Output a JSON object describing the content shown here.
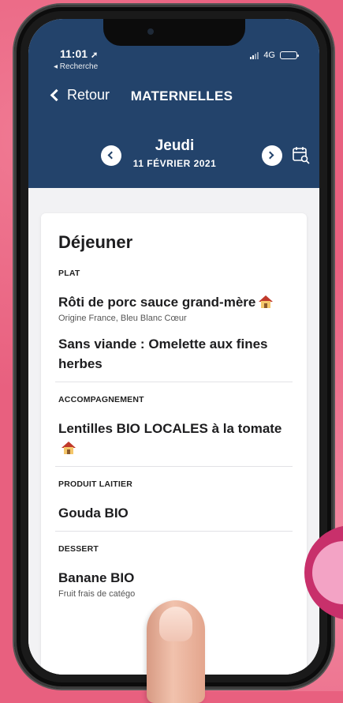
{
  "status": {
    "time": "11:01",
    "back_app": "◂ Recherche",
    "network": "4G",
    "battery_level": 0.85
  },
  "nav": {
    "back_label": "Retour",
    "title": "MATERNELLES"
  },
  "date": {
    "day": "Jeudi",
    "full": "11 FÉVRIER 2021"
  },
  "menu": {
    "meal_title": "Déjeuner",
    "sections": [
      {
        "label": "PLAT",
        "dishes": [
          {
            "name": "Rôti de porc sauce grand-mère",
            "local_icon": "house-icon",
            "note": "Origine France, Bleu Blanc Cœur"
          },
          {
            "name": "Sans viande : Omelette aux fines herbes"
          }
        ]
      },
      {
        "label": "ACCOMPAGNEMENT",
        "dishes": [
          {
            "name": "Lentilles BIO LOCALES à la tomate",
            "local_icon": "house-icon"
          }
        ]
      },
      {
        "label": "PRODUIT LAITIER",
        "dishes": [
          {
            "name": "Gouda BIO"
          }
        ]
      },
      {
        "label": "DESSERT",
        "dishes": [
          {
            "name": "Banane BIO",
            "note": "Fruit frais de catégo"
          }
        ]
      }
    ]
  },
  "colors": {
    "header_bg": "#23436b",
    "page_bg": "#e8607f",
    "card_bg": "#ffffff",
    "local_house_roof": "#c0392b"
  },
  "icons": {
    "back": "chevron-left-icon",
    "prev_day": "chevron-left-circle-icon",
    "next_day": "chevron-right-circle-icon",
    "calendar": "calendar-search-icon",
    "local": "house-icon"
  }
}
